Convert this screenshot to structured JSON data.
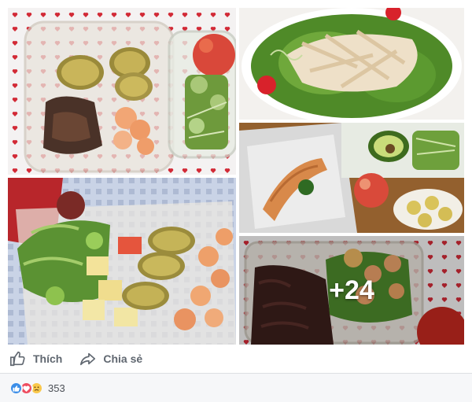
{
  "post": {
    "photos": [
      {
        "alt_icon": "photo-lunchbox-sweet-potato-beef-shrimp"
      },
      {
        "alt_icon": "photo-chicken-salad"
      },
      {
        "alt_icon": "photo-salmon-foil-avocado"
      },
      {
        "alt_icon": "photo-salad-shrimp-sweet-potato"
      },
      {
        "alt_icon": "photo-red-rice-shrimp"
      }
    ],
    "more_photos_label": "+24"
  },
  "actions": {
    "like_label": "Thích",
    "share_label": "Chia sẻ",
    "like_icon": "thumbs-up-icon",
    "share_icon": "share-arrow-icon"
  },
  "reactions": {
    "icons": [
      "like-reaction-icon",
      "love-reaction-icon",
      "sad-reaction-icon"
    ],
    "count": "353"
  },
  "colors": {
    "action_text": "#606770",
    "like_blue": "#3b8ee8",
    "love_red": "#ee4d60",
    "sad_yellow": "#f9c84b",
    "footer_bg": "#f6f7f9"
  }
}
